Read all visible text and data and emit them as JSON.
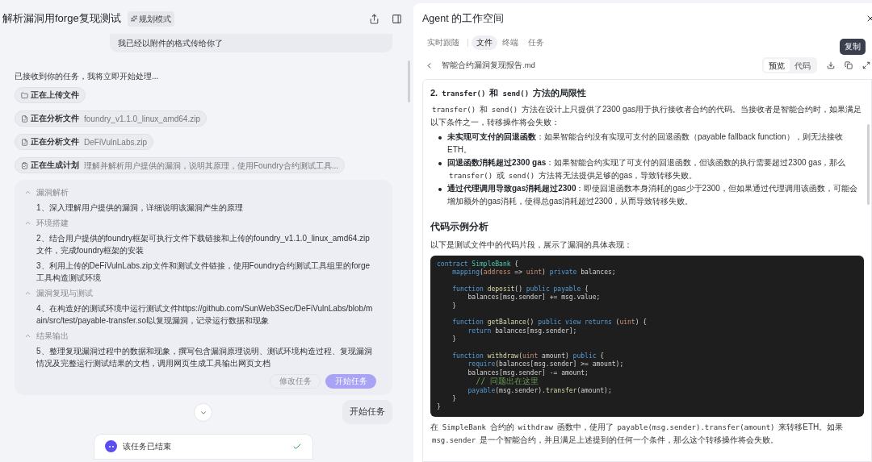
{
  "chat": {
    "title": "解析漏洞用forge复现测试",
    "mode_tag": "规划模式",
    "user_message": "我已经以附件的格式传给你了",
    "reply": "已接收到你的任务，我将立即开始处理...",
    "steps": [
      {
        "kind": "upload",
        "label": "正在上传文件"
      },
      {
        "kind": "analyze",
        "label": "正在分析文件",
        "detail": "foundry_v1.1.0_linux_amd64.zip"
      },
      {
        "kind": "analyze",
        "label": "正在分析文件",
        "detail": "DeFiVulnLabs.zip"
      },
      {
        "kind": "plan",
        "label": "正在生成计划",
        "detail": "理解并解析用户提供的漏洞，说明其原理，使用Foundry合约测试工具..."
      }
    ],
    "plan": {
      "sections": [
        {
          "title": "漏洞解析",
          "expanded": true,
          "items": [
            "1、深入理解用户提供的漏洞，详细说明该漏洞产生的原理"
          ]
        },
        {
          "title": "环境搭建",
          "expanded": true,
          "items": [
            "2、结合用户提供的foundry框架可执行文件下载链接和上传的foundry_v1.1.0_linux_amd64.zip文件，完成foundry框架的安装",
            "3、利用上传的DeFiVulnLabs.zip文件和测试文件链接，使用Foundry合约测试工具组里的forge工具构造测试环境"
          ]
        },
        {
          "title": "漏洞复现与测试",
          "expanded": true,
          "items": [
            "4、在构造好的测试环境中运行测试文件https://github.com/SunWeb3Sec/DeFiVulnLabs/blob/main/src/test/payable-transfer.sol以复现漏洞，记录运行数据和现象"
          ]
        },
        {
          "title": "结果输出",
          "expanded": true,
          "items": [
            "5、整理复现漏洞过程中的数据和现象，撰写包含漏洞原理说明、测试环境构造过程、复现漏洞情况及完整运行测试结果的文档，调用网页生成工具输出网页文档"
          ]
        }
      ],
      "buttons": [
        {
          "label": "修改任务",
          "kind": "secondary",
          "disabled": true
        },
        {
          "label": "开始任务",
          "kind": "primary",
          "disabled": true
        }
      ]
    },
    "user_message_2": "开始任务",
    "status": {
      "text": "该任务已结束",
      "done": true
    }
  },
  "workspace": {
    "title": "Agent 的工作空间",
    "tabs": [
      {
        "label": "实时跟随",
        "selected": false
      },
      {
        "label": "文件",
        "selected": true
      },
      {
        "label": "终端",
        "selected": false
      },
      {
        "label": "任务",
        "selected": false
      }
    ],
    "tooltip": "复制",
    "file_name": "智能合约漏洞复现报告.md",
    "view_modes": [
      {
        "label": "预览",
        "selected": true
      },
      {
        "label": "代码",
        "selected": false
      }
    ],
    "doc": [
      {
        "kind": "h3",
        "segments": [
          {
            "kind": "bold",
            "text": "2. "
          },
          {
            "kind": "code",
            "text": "transfer()"
          },
          {
            "kind": "bold",
            "text": " 和 "
          },
          {
            "kind": "code",
            "text": "send()"
          },
          {
            "kind": "bold",
            "text": " 方法的局限性"
          }
        ]
      },
      {
        "kind": "p",
        "segments": [
          {
            "kind": "code",
            "text": "transfer()"
          },
          {
            "kind": "text",
            "text": " 和 "
          },
          {
            "kind": "code",
            "text": "send()"
          },
          {
            "kind": "text",
            "text": " 方法在设计上只提供了2300 gas用于执行接收者合约的代码。当接收者是智能合约时，如果满足以下条件之一，转移操作将会失败："
          }
        ]
      },
      {
        "kind": "li",
        "segments": [
          {
            "kind": "bold",
            "text": "未实现可支付的回退函数"
          },
          {
            "kind": "text",
            "text": "：如果智能合约没有实现可支付的回退函数（payable fallback function），则无法接收ETH。"
          }
        ]
      },
      {
        "kind": "li",
        "segments": [
          {
            "kind": "bold",
            "text": "回退函数消耗超过2300 gas"
          },
          {
            "kind": "text",
            "text": "：如果智能合约实现了可支付的回退函数，但该函数的执行需要超过2300 gas，那么 "
          },
          {
            "kind": "code",
            "text": "transfer()"
          },
          {
            "kind": "text",
            "text": " 或 "
          },
          {
            "kind": "code",
            "text": "send()"
          },
          {
            "kind": "text",
            "text": " 方法将无法提供足够的gas，导致转移失败。"
          }
        ]
      },
      {
        "kind": "li",
        "segments": [
          {
            "kind": "bold",
            "text": "通过代理调用导致gas消耗超过2300"
          },
          {
            "kind": "text",
            "text": "：即使回退函数本身消耗的gas少于2300，但如果通过代理调用该函数，可能会增加额外的gas消耗，使得总gas消耗超过2300，从而导致转移失败。"
          }
        ]
      },
      {
        "kind": "h2",
        "segments": [
          {
            "kind": "bold",
            "text": "代码示例分析"
          }
        ]
      },
      {
        "kind": "p",
        "segments": [
          {
            "kind": "text",
            "text": "以下是测试文件中的代码片段，展示了漏洞的具体表现："
          }
        ]
      },
      {
        "kind": "code",
        "blocks": [
          [
            [
              {
                "kind": "kw",
                "text": "contract "
              },
              {
                "kind": "type",
                "text": "SimpleBank"
              },
              {
                "kind": "plain",
                "text": " {"
              }
            ],
            [
              {
                "kind": "kw",
                "text": "    mapping"
              },
              {
                "kind": "plain",
                "text": "("
              },
              {
                "kind": "param",
                "text": "address"
              },
              {
                "kind": "plain",
                "text": " => "
              },
              {
                "kind": "param",
                "text": "uint"
              },
              {
                "kind": "plain",
                "text": ") "
              },
              {
                "kind": "kw",
                "text": "private"
              },
              {
                "kind": "plain",
                "text": " balances;"
              }
            ]
          ],
          [
            [
              {
                "kind": "kw",
                "text": "    function "
              },
              {
                "kind": "fn",
                "text": "deposit"
              },
              {
                "kind": "plain",
                "text": "() "
              },
              {
                "kind": "kw",
                "text": "public payable"
              },
              {
                "kind": "plain",
                "text": " {"
              }
            ],
            [
              {
                "kind": "plain",
                "text": "        balances[msg.sender] += msg.value;"
              }
            ],
            [
              {
                "kind": "plain",
                "text": "    }"
              }
            ]
          ],
          [
            [
              {
                "kind": "kw",
                "text": "    function "
              },
              {
                "kind": "fn",
                "text": "getBalance"
              },
              {
                "kind": "plain",
                "text": "() "
              },
              {
                "kind": "kw",
                "text": "public view returns"
              },
              {
                "kind": "plain",
                "text": " ("
              },
              {
                "kind": "param",
                "text": "uint"
              },
              {
                "kind": "plain",
                "text": ") {"
              }
            ],
            [
              {
                "kind": "kw",
                "text": "        return"
              },
              {
                "kind": "plain",
                "text": " balances[msg.sender];"
              }
            ],
            [
              {
                "kind": "plain",
                "text": "    }"
              }
            ]
          ],
          [
            [
              {
                "kind": "kw",
                "text": "    function "
              },
              {
                "kind": "fn",
                "text": "withdraw"
              },
              {
                "kind": "plain",
                "text": "("
              },
              {
                "kind": "param",
                "text": "uint"
              },
              {
                "kind": "plain",
                "text": " amount) "
              },
              {
                "kind": "kw",
                "text": "public"
              },
              {
                "kind": "plain",
                "text": " {"
              }
            ],
            [
              {
                "kind": "kw",
                "text": "        require"
              },
              {
                "kind": "plain",
                "text": "(balances[msg.sender] >= amount);"
              }
            ],
            [
              {
                "kind": "plain",
                "text": "        balances[msg.sender] -= amount;"
              }
            ],
            [
              {
                "kind": "comment",
                "text": "        // 问题出在这里"
              }
            ],
            [
              {
                "kind": "kw",
                "text": "        payable"
              },
              {
                "kind": "plain",
                "text": "(msg.sender)."
              },
              {
                "kind": "fn",
                "text": "transfer"
              },
              {
                "kind": "plain",
                "text": "(amount);"
              }
            ],
            [
              {
                "kind": "plain",
                "text": "    }"
              }
            ],
            [
              {
                "kind": "plain",
                "text": "}"
              }
            ]
          ]
        ]
      },
      {
        "kind": "p",
        "segments": [
          {
            "kind": "text",
            "text": "在 "
          },
          {
            "kind": "code",
            "text": "SimpleBank"
          },
          {
            "kind": "text",
            "text": " 合约的 "
          },
          {
            "kind": "code",
            "text": "withdraw"
          },
          {
            "kind": "text",
            "text": " 函数中，使用了 "
          },
          {
            "kind": "code",
            "text": "payable(msg.sender).transfer(amount)"
          },
          {
            "kind": "text",
            "text": " 来转移ETH。如果 "
          },
          {
            "kind": "code",
            "text": "msg.sender"
          },
          {
            "kind": "text",
            "text": " 是一个智能合约，并且满足上述提到的任何一个条件，那么这个转移操作将会失败。"
          }
        ]
      }
    ]
  }
}
